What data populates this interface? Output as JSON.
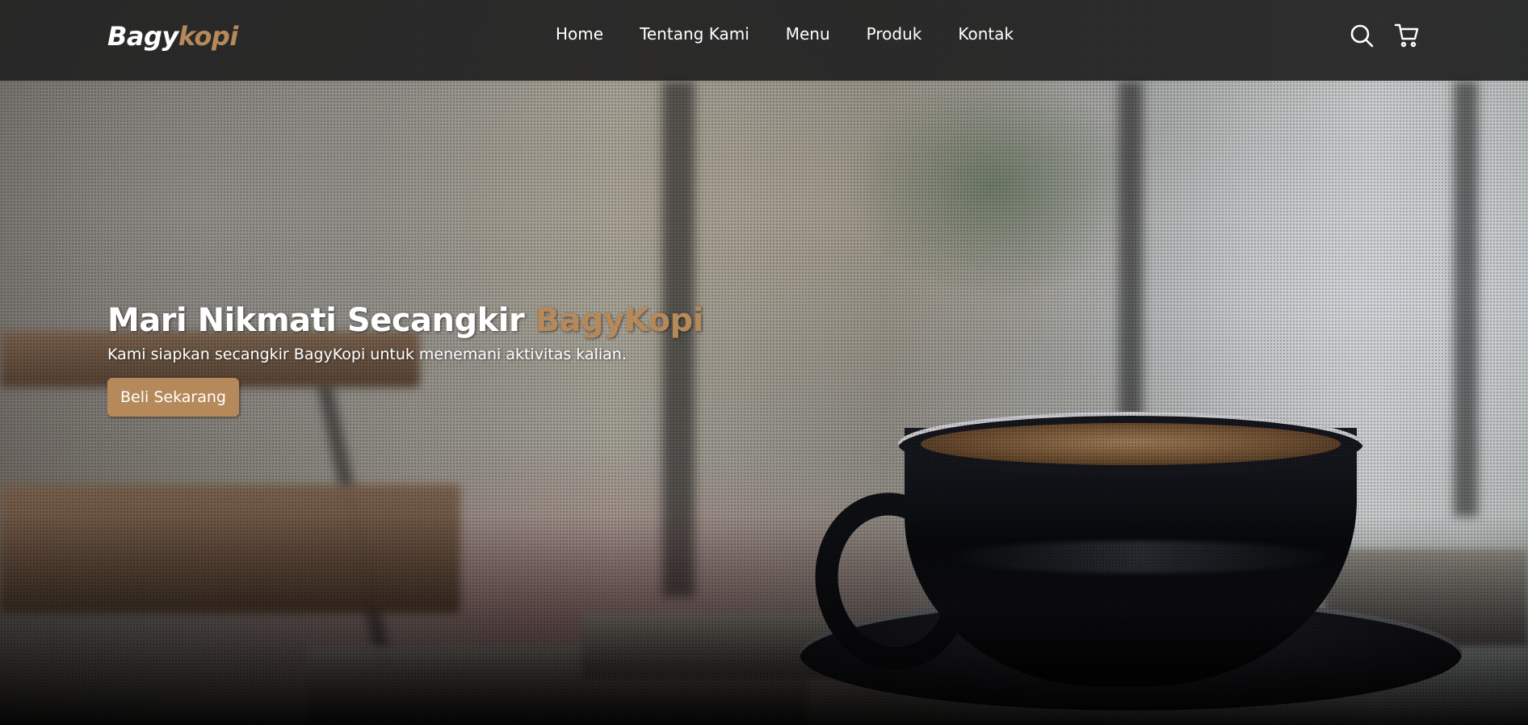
{
  "brand": {
    "name_main": "Bagy",
    "name_accent": "kopi",
    "accent_color": "#b6895b"
  },
  "nav": {
    "links": [
      {
        "label": "Home"
      },
      {
        "label": "Tentang Kami"
      },
      {
        "label": "Menu"
      },
      {
        "label": "Produk"
      },
      {
        "label": "Kontak"
      }
    ],
    "icons": [
      "search-icon",
      "shopping-cart-icon"
    ]
  },
  "hero": {
    "title_main": "Mari Nikmati Secangkir ",
    "title_accent": "BagyKopi",
    "description": "Kami siapkan secangkir BagyKopi untuk menemani aktivitas kalian.",
    "cta_label": "Beli Sekarang"
  }
}
